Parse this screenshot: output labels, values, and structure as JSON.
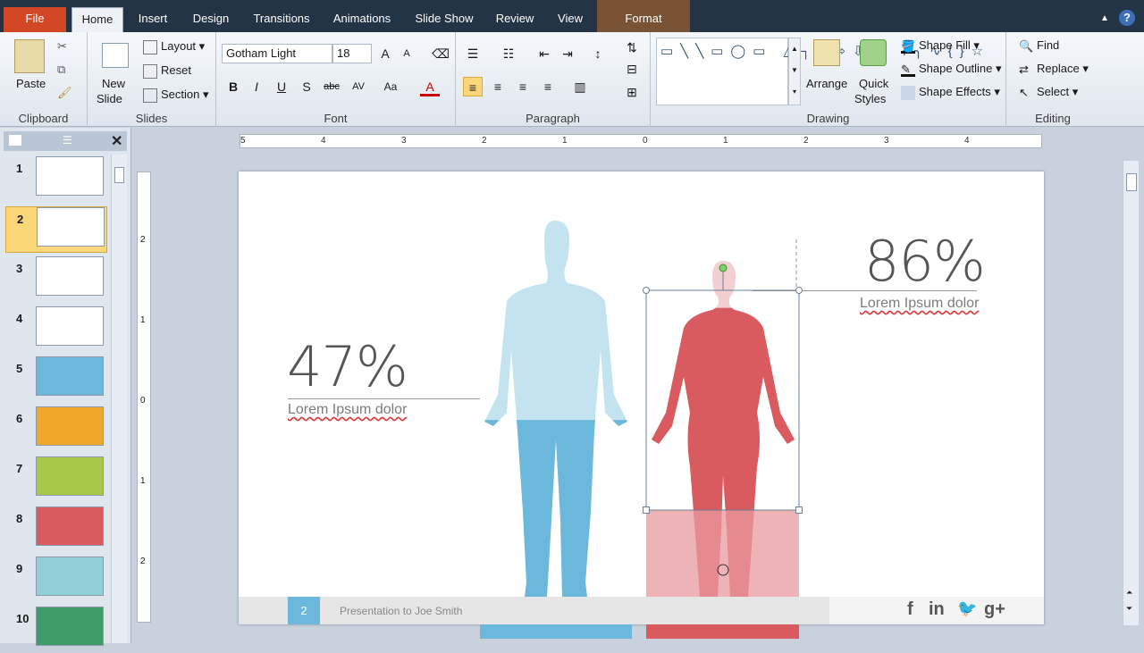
{
  "tabs": [
    "File",
    "Home",
    "Insert",
    "Design",
    "Transitions",
    "Animations",
    "Slide Show",
    "Review",
    "View",
    "Format"
  ],
  "ribbon": {
    "clipboard": {
      "label": "Clipboard",
      "paste": "Paste"
    },
    "slides": {
      "label": "Slides",
      "new_slide": "New",
      "new_slide2": "Slide",
      "layout": "Layout",
      "reset": "Reset",
      "section": "Section"
    },
    "font": {
      "label": "Font",
      "name": "Gotham Light",
      "size": "18"
    },
    "paragraph": {
      "label": "Paragraph"
    },
    "drawing": {
      "label": "Drawing",
      "arrange": "Arrange",
      "quick": "Quick",
      "styles": "Styles",
      "fill": "Shape Fill",
      "outline": "Shape Outline",
      "effects": "Shape Effects"
    },
    "editing": {
      "label": "Editing",
      "find": "Find",
      "replace": "Replace",
      "select": "Select"
    }
  },
  "slides": [
    {
      "n": "1",
      "color": "#ffffff"
    },
    {
      "n": "2",
      "color": "#ffffff"
    },
    {
      "n": "3",
      "color": "#ffffff"
    },
    {
      "n": "4",
      "color": "#ffffff"
    },
    {
      "n": "5",
      "color": "#6bb8dc"
    },
    {
      "n": "6",
      "color": "#f0a82a"
    },
    {
      "n": "7",
      "color": "#a8c84a"
    },
    {
      "n": "8",
      "color": "#d95b5f"
    },
    {
      "n": "9",
      "color": "#8fcfd6"
    },
    {
      "n": "10",
      "color": "#3f9c6a"
    }
  ],
  "ruler": [
    "5",
    "4",
    "3",
    "2",
    "1",
    "0",
    "1",
    "2",
    "3",
    "4"
  ],
  "ruler_v": [
    "2",
    "1",
    "0",
    "1",
    "2"
  ],
  "slide": {
    "left_pct": "47%",
    "left_text": "Lorem Ipsum dolor",
    "right_pct": "86%",
    "right_text": "Lorem Ipsum dolor",
    "page": "2",
    "presenter": "Presentation to Joe Smith",
    "social": [
      "f",
      "in",
      "ὂ6",
      "g+"
    ],
    "colors": {
      "male": "#6bb8dc",
      "female": "#d95b5f"
    },
    "male_fill": 0.47,
    "female_fill": 0.86
  }
}
